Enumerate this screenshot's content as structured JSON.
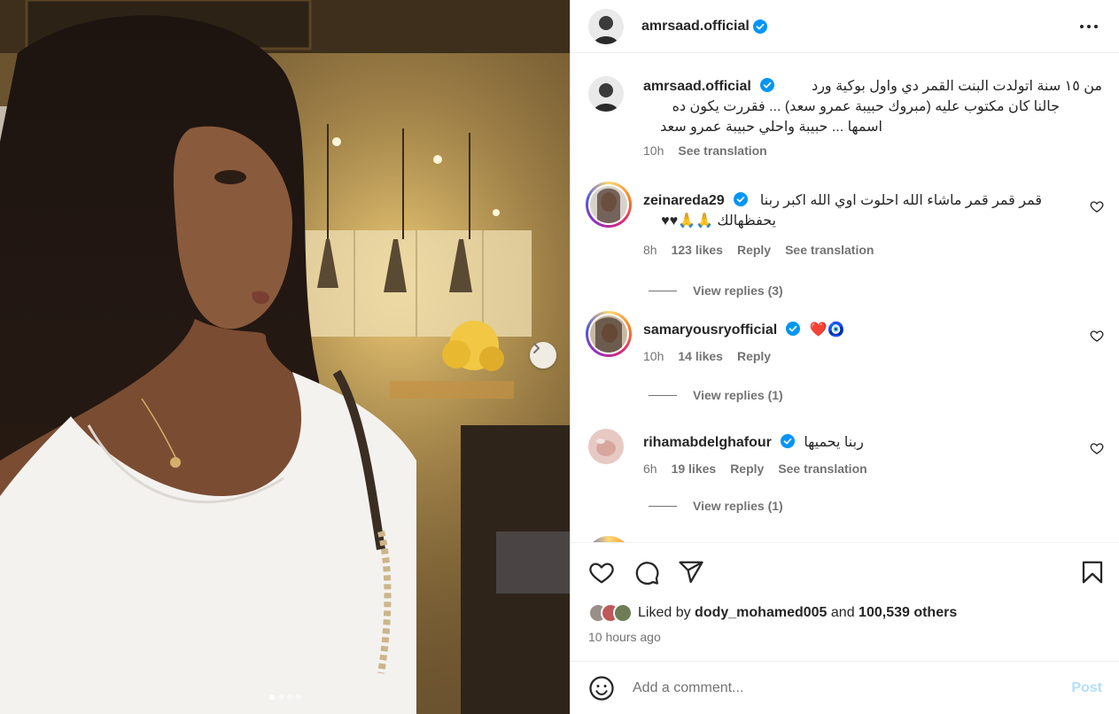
{
  "post": {
    "author": "amrsaad.official",
    "carousel_slides": 4,
    "carousel_active_slide": 1
  },
  "caption": {
    "username": "amrsaad.official",
    "lines": [
      "من ١٥ سنة اتولدت البنت القمر دي واول بوكية ورد",
      "جالنا كان مكتوب عليه (مبروك حبيبة عمرو سعد) ... فقررت يكون ده",
      "اسمها ... حبيبة واحلي حبيبة عمرو سعد"
    ],
    "time": "10h",
    "translate": "See translation"
  },
  "comments": [
    {
      "username": "zeinareda29",
      "line1": "قمر قمر قمر ماشاء الله احلوت اوي الله اكبر ربنا",
      "line2": "يحفظهالك 🙏🙏♥♥",
      "time": "8h",
      "likes": "123 likes",
      "reply": "Reply",
      "translate": "See translation",
      "view_replies": "View replies (3)"
    },
    {
      "username": "samaryousryofficial",
      "line1": "❤️🧿",
      "time": "10h",
      "likes": "14 likes",
      "reply": "Reply",
      "view_replies": "View replies (1)"
    },
    {
      "username": "rihamabdelghafour",
      "line1": "ربنا يحميها",
      "time": "6h",
      "likes": "19 likes",
      "reply": "Reply",
      "translate": "See translation",
      "view_replies": "View replies (1)"
    }
  ],
  "likes": {
    "prefix": "Liked by",
    "first_user": "dody_mohamed005",
    "and": "and",
    "others": "100,539 others"
  },
  "timestamp": "10 hours ago",
  "add_comment": {
    "placeholder": "Add a comment...",
    "post_label": "Post"
  },
  "colors": {
    "verified": "#0095f6",
    "text": "#262626",
    "muted": "#737373",
    "post_disabled": "#b2dffc"
  }
}
